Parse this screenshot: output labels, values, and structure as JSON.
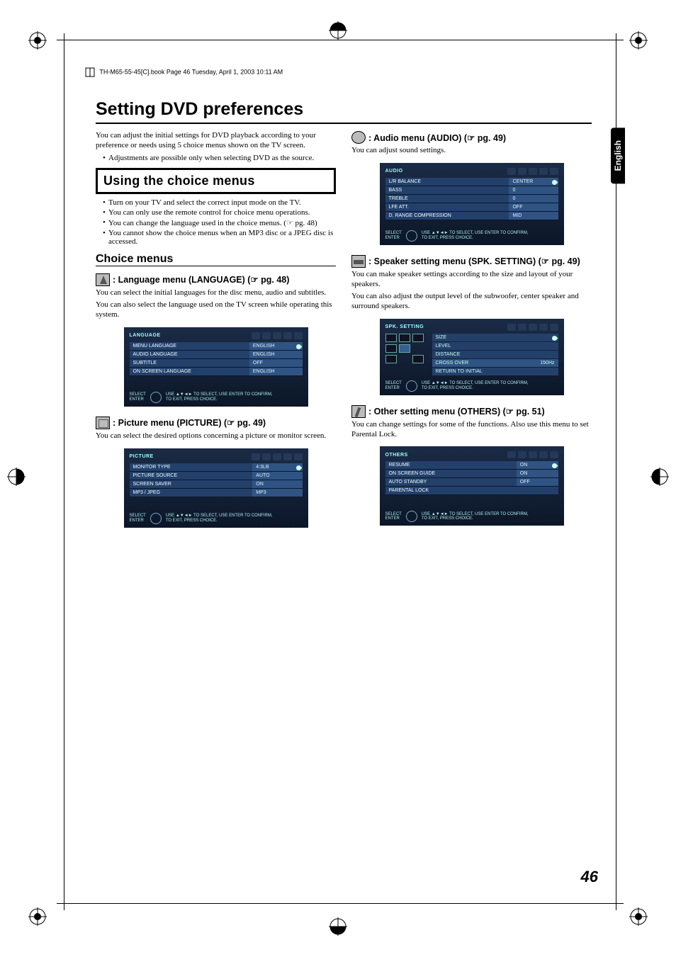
{
  "header": "TH-M65-55-45[C].book  Page 46  Tuesday, April 1, 2003  10:11 AM",
  "title": "Setting DVD preferences",
  "intro": "You can adjust the initial settings for DVD playback according to your preference or needs using 5 choice menus shown on the TV screen.",
  "intro_bullets": [
    "Adjustments are possible only when selecting DVD as the source."
  ],
  "box_heading": "Using the choice menus",
  "box_bullets": [
    "Turn on your TV and select the correct input mode on the TV.",
    "You can only use the remote control for choice menu operations.",
    "You can change the language used in the choice menus. (☞ pg. 48)",
    "You cannot show the choice menus when an MP3 disc or a JPEG disc is accessed."
  ],
  "choice_heading": "Choice menus",
  "sections": {
    "language": {
      "title": ": Language menu (LANGUAGE) (☞ pg. 48)",
      "desc": [
        "You can select the initial languages for the disc menu, audio and subtitles.",
        "You can also select the language used on the TV screen while operating this system."
      ],
      "osd_title": "LANGUAGE",
      "rows": [
        [
          "MENU LANGUAGE",
          "ENGLISH"
        ],
        [
          "AUDIO LANGUAGE",
          "ENGLISH"
        ],
        [
          "SUBTITLE",
          "OFF"
        ],
        [
          "ON SCREEN LANGUAGE",
          "ENGLISH"
        ]
      ]
    },
    "picture": {
      "title": ": Picture menu (PICTURE) (☞ pg. 49)",
      "desc": [
        "You can select the desired options concerning a picture or monitor screen."
      ],
      "osd_title": "PICTURE",
      "rows": [
        [
          "MONITOR TYPE",
          "4:3LB"
        ],
        [
          "PICTURE SOURCE",
          "AUTO"
        ],
        [
          "SCREEN SAVER",
          "ON"
        ],
        [
          "MP3 / JPEG",
          "MP3"
        ]
      ]
    },
    "audio": {
      "title": ": Audio menu (AUDIO) (☞ pg. 49)",
      "desc": [
        "You can adjust sound settings."
      ],
      "osd_title": "AUDIO",
      "rows": [
        [
          "L/R BALANCE",
          "CENTER"
        ],
        [
          "BASS",
          "0"
        ],
        [
          "TREBLE",
          "0"
        ],
        [
          "LFE ATT.",
          "OFF"
        ],
        [
          "D. RANGE COMPRESSION",
          "MID"
        ]
      ]
    },
    "speaker": {
      "title": ": Speaker setting menu (SPK. SETTING) (☞ pg. 49)",
      "desc": [
        "You can make speaker settings according to the size and layout of your speakers.",
        "You can also adjust the output level of the subwoofer, center speaker and surround speakers."
      ],
      "osd_title": "SPK. SETTING",
      "items": [
        "SIZE",
        "LEVEL",
        "DISTANCE",
        "CROSS OVER",
        "RETURN TO INITIAL"
      ],
      "crossover_val": "150Hz"
    },
    "others": {
      "title": ": Other setting menu (OTHERS) (☞ pg. 51)",
      "desc": [
        "You can change settings for some of the functions. Also use this menu to set Parental Lock."
      ],
      "osd_title": "OTHERS",
      "rows": [
        [
          "RESUME",
          "ON"
        ],
        [
          "ON SCREEN GUIDE",
          "ON"
        ],
        [
          "AUTO STANDBY",
          "OFF"
        ],
        [
          "PARENTAL LOCK",
          ""
        ]
      ]
    }
  },
  "osd_footer": {
    "select": "SELECT",
    "enter": "ENTER",
    "msg1": "USE ▲▼◄► TO SELECT,  USE ENTER TO CONFIRM,",
    "msg2": "TO EXIT, PRESS CHOICE."
  },
  "side_tab": "English",
  "page_number": "46"
}
